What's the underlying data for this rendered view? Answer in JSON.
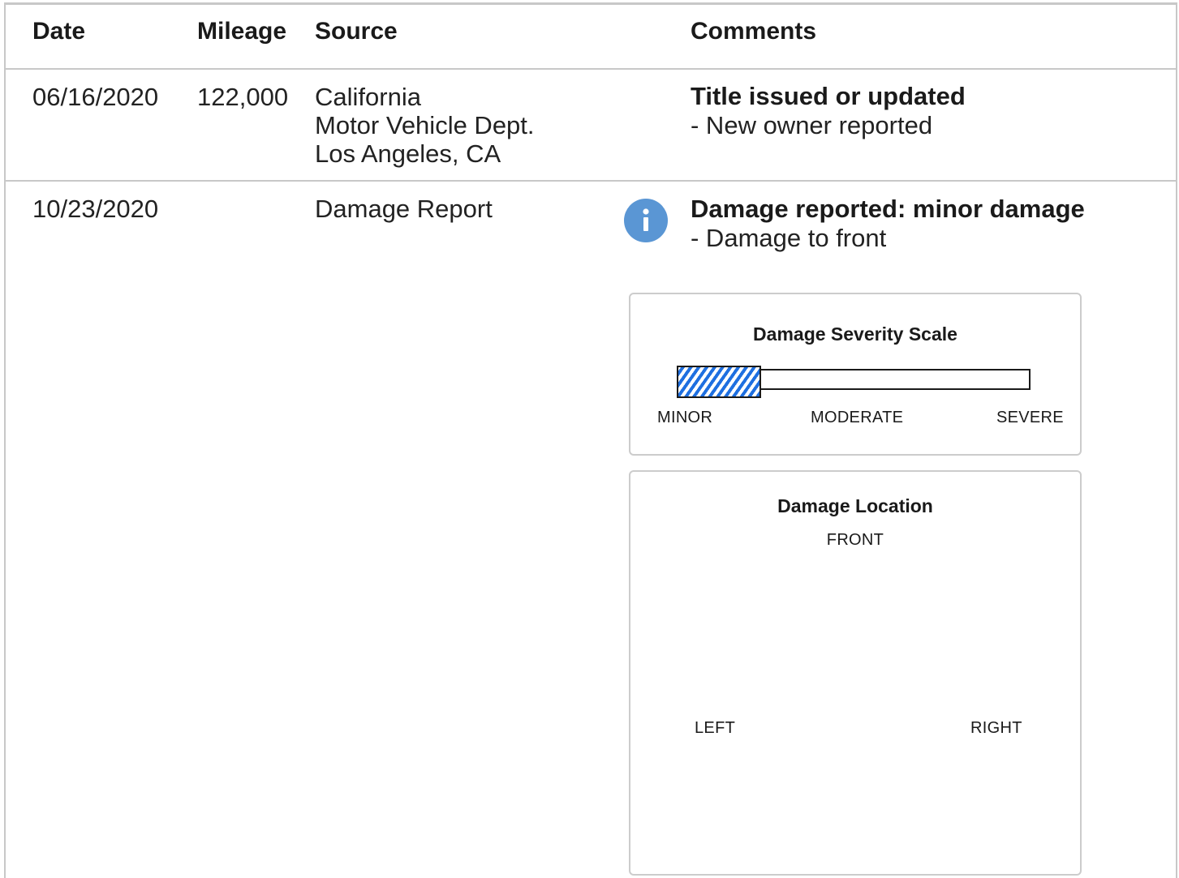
{
  "table": {
    "headers": {
      "date": "Date",
      "mileage": "Mileage",
      "source": "Source",
      "comments": "Comments"
    },
    "rows": [
      {
        "date": "06/16/2020",
        "mileage": "122,000",
        "source": [
          "California",
          "Motor Vehicle Dept.",
          "Los Angeles, CA"
        ],
        "comment_title": "Title issued or updated",
        "comment_details": [
          "- New owner reported"
        ]
      },
      {
        "date": "10/23/2020",
        "mileage": "",
        "source": [
          "Damage Report"
        ],
        "icon": "info-icon",
        "comment_title": "Damage reported: minor damage",
        "comment_details": [
          "- Damage to front"
        ]
      }
    ]
  },
  "severity_scale": {
    "title": "Damage Severity Scale",
    "labels": [
      "MINOR",
      "MODERATE",
      "SEVERE"
    ],
    "level": 0.24,
    "fill_color": "#1e6fe0"
  },
  "damage_location": {
    "title": "Damage Location",
    "front_label": "FRONT",
    "left_label": "LEFT",
    "right_label": "RIGHT"
  },
  "colors": {
    "info_icon": "#5a96d4",
    "rule": "#c8c8c8"
  }
}
